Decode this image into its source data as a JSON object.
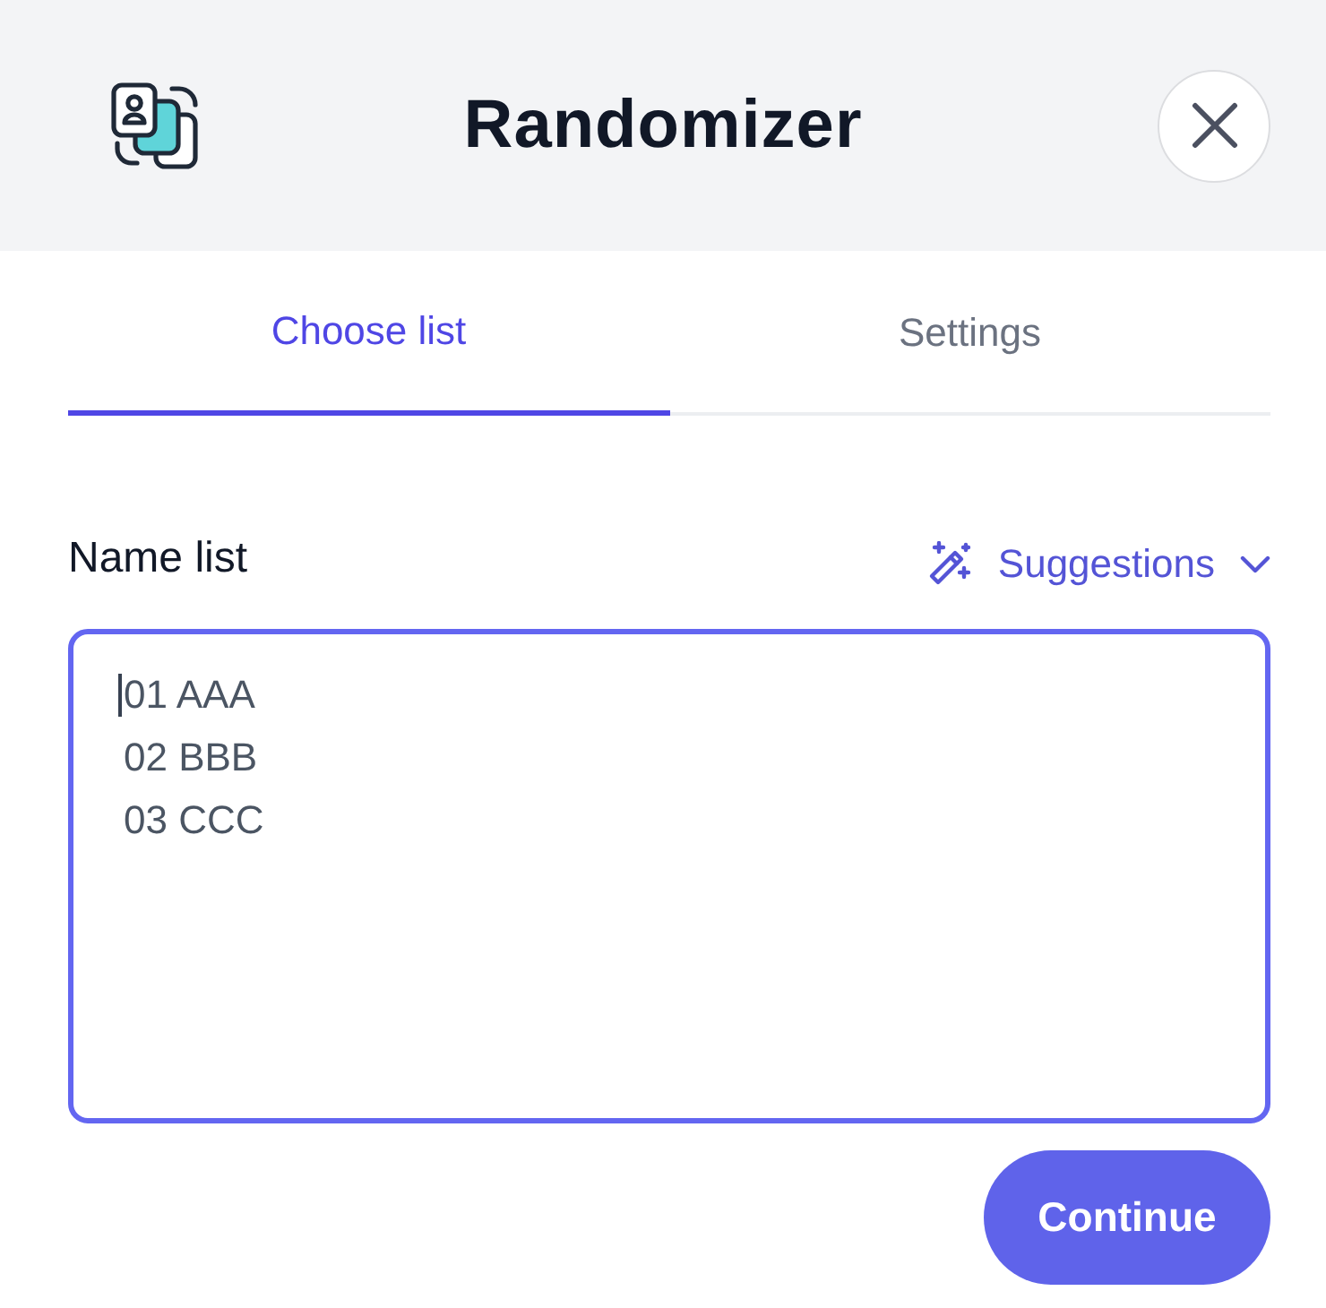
{
  "header": {
    "title": "Randomizer"
  },
  "tabs": [
    {
      "label": "Choose list",
      "selected": true
    },
    {
      "label": "Settings",
      "selected": false
    }
  ],
  "name_list": {
    "label": "Name list",
    "suggestions": {
      "label": "Suggestions"
    },
    "placeholder": "01 AAA\n02 BBB\n03 CCC",
    "focused": true
  },
  "continue_button": {
    "label": "Continue"
  }
}
